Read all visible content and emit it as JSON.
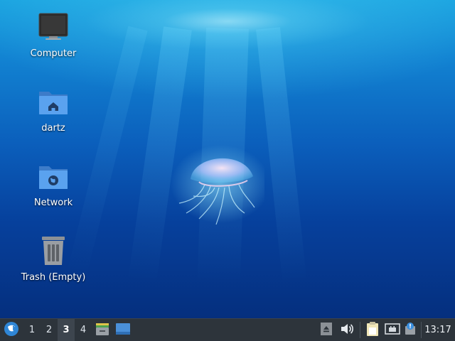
{
  "desktop": {
    "icons": [
      {
        "label": "Computer",
        "icon": "computer-icon"
      },
      {
        "label": "dartz",
        "icon": "home-folder-icon"
      },
      {
        "label": "Network",
        "icon": "network-folder-icon"
      },
      {
        "label": "Trash (Empty)",
        "icon": "trash-icon"
      }
    ],
    "wallpaper": "jellyfish-underwater"
  },
  "panel": {
    "menu_icon": "whisker-menu-icon",
    "workspaces": [
      "1",
      "2",
      "3",
      "4"
    ],
    "active_workspace": "3",
    "launchers": [
      "file-manager-icon",
      "show-desktop-icon"
    ],
    "tray": [
      "eject-icon",
      "volume-icon",
      "clipboard-icon",
      "network-wired-icon",
      "notification-icon"
    ],
    "clock": "13:17"
  },
  "colors": {
    "panel_bg": "#2d343b",
    "accent": "#4a90d9"
  }
}
